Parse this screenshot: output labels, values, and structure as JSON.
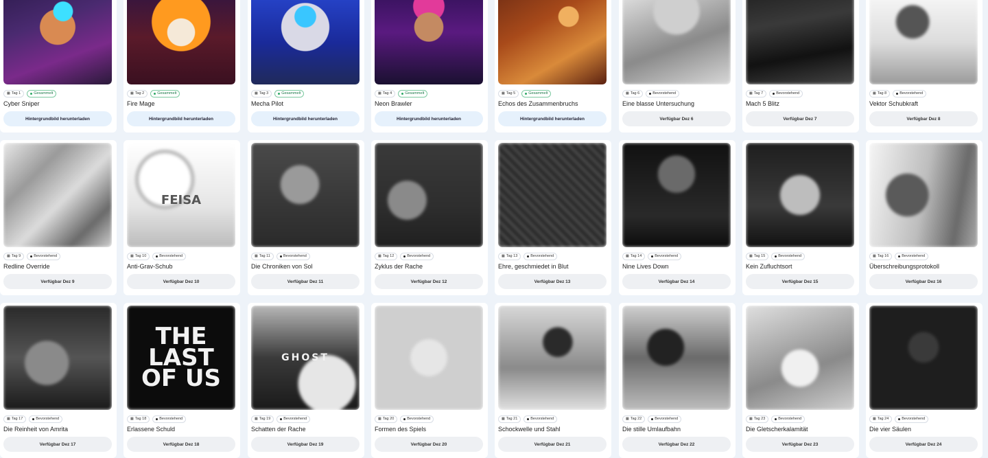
{
  "cards": [
    {
      "day": "Tag 1",
      "status": "Gesammelt",
      "collected": true,
      "title": "Cyber Sniper",
      "button": "Hintergrundbild herunterladen",
      "art": "a1"
    },
    {
      "day": "Tag 2",
      "status": "Gesammelt",
      "collected": true,
      "title": "Fire Mage",
      "button": "Hintergrundbild herunterladen",
      "art": "a2"
    },
    {
      "day": "Tag 3",
      "status": "Gesammelt",
      "collected": true,
      "title": "Mecha Pilot",
      "button": "Hintergrundbild herunterladen",
      "art": "a3"
    },
    {
      "day": "Tag 4",
      "status": "Gesammelt",
      "collected": true,
      "title": "Neon Brawler",
      "button": "Hintergrundbild herunterladen",
      "art": "a4"
    },
    {
      "day": "Tag 5",
      "status": "Gesammelt",
      "collected": true,
      "title": "Echos des Zusammenbruchs",
      "button": "Hintergrundbild herunterladen",
      "art": "a5"
    },
    {
      "day": "Tag 6",
      "status": "Bevorstehend",
      "collected": false,
      "title": "Eine blasse Untersuchung",
      "button": "Verfügbar Dez 6",
      "art": "g1"
    },
    {
      "day": "Tag 7",
      "status": "Bevorstehend",
      "collected": false,
      "title": "Mach 5 Blitz",
      "button": "Verfügbar Dez 7",
      "art": "g2"
    },
    {
      "day": "Tag 8",
      "status": "Bevorstehend",
      "collected": false,
      "title": "Vektor Schubkraft",
      "button": "Verfügbar Dez 8",
      "art": "g3"
    },
    {
      "day": "Tag 9",
      "status": "Bevorstehend",
      "collected": false,
      "title": "Redline Override",
      "button": "Verfügbar Dez 9",
      "art": "g4"
    },
    {
      "day": "Tag 10",
      "status": "Bevorstehend",
      "collected": false,
      "title": "Anti-Grav-Schub",
      "button": "Verfügbar Dez 10",
      "art": "g5",
      "art_text": "FEISA"
    },
    {
      "day": "Tag 11",
      "status": "Bevorstehend",
      "collected": false,
      "title": "Die Chroniken von Sol",
      "button": "Verfügbar Dez 11",
      "art": "g6"
    },
    {
      "day": "Tag 12",
      "status": "Bevorstehend",
      "collected": false,
      "title": "Zyklus der Rache",
      "button": "Verfügbar Dez 12",
      "art": "g7"
    },
    {
      "day": "Tag 13",
      "status": "Bevorstehend",
      "collected": false,
      "title": "Ehre, geschmiedet in Blut",
      "button": "Verfügbar Dez 13",
      "art": "g8"
    },
    {
      "day": "Tag 14",
      "status": "Bevorstehend",
      "collected": false,
      "title": "Nine Lives Down",
      "button": "Verfügbar Dez 14",
      "art": "g9"
    },
    {
      "day": "Tag 15",
      "status": "Bevorstehend",
      "collected": false,
      "title": "Kein Zufluchtsort",
      "button": "Verfügbar Dez 15",
      "art": "g10"
    },
    {
      "day": "Tag 16",
      "status": "Bevorstehend",
      "collected": false,
      "title": "Überschreibungsprotokoll",
      "button": "Verfügbar Dez 16",
      "art": "g11"
    },
    {
      "day": "Tag 17",
      "status": "Bevorstehend",
      "collected": false,
      "title": "Die Reinheit von Amrita",
      "button": "Verfügbar Dez 17",
      "art": "g12"
    },
    {
      "day": "Tag 18",
      "status": "Bevorstehend",
      "collected": false,
      "title": "Erlassene Schuld",
      "button": "Verfügbar Dez 18",
      "art": "g13",
      "art_text": "THE LAST OF US"
    },
    {
      "day": "Tag 19",
      "status": "Bevorstehend",
      "collected": false,
      "title": "Schatten der Rache",
      "button": "Verfügbar Dez 19",
      "art": "g14",
      "art_text": "GHOST"
    },
    {
      "day": "Tag 20",
      "status": "Bevorstehend",
      "collected": false,
      "title": "Formen des Spiels",
      "button": "Verfügbar Dez 20",
      "art": "g15"
    },
    {
      "day": "Tag 21",
      "status": "Bevorstehend",
      "collected": false,
      "title": "Schockwelle und Stahl",
      "button": "Verfügbar Dez 21",
      "art": "g16"
    },
    {
      "day": "Tag 22",
      "status": "Bevorstehend",
      "collected": false,
      "title": "Die stille Umlaufbahn",
      "button": "Verfügbar Dez 22",
      "art": "g17"
    },
    {
      "day": "Tag 23",
      "status": "Bevorstehend",
      "collected": false,
      "title": "Die Gletscherkalamität",
      "button": "Verfügbar Dez 23",
      "art": "g18"
    },
    {
      "day": "Tag 24",
      "status": "Bevorstehend",
      "collected": false,
      "title": "Die vier Säulen",
      "button": "Verfügbar Dez 24",
      "art": "g19"
    }
  ],
  "icons": {
    "calendar": "calendar-icon",
    "status_dot": "status-dot-icon"
  },
  "colors": {
    "collected_border": "#7cc9a0",
    "collected_dot": "#2fa866",
    "download_button_bg": "#e6f1fc",
    "locked_button_bg": "#eef0f3",
    "page_bg": "#eef3f9"
  }
}
